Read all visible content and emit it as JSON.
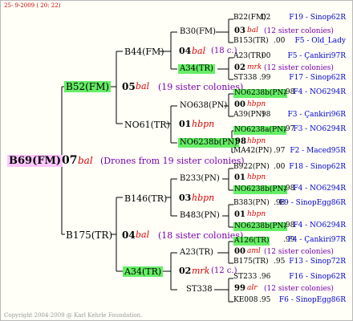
{
  "header": "25-  9-2009  ( 20: 22)",
  "footer": "Copyright 2004-2009 @ Karl Kehrle Foundation.",
  "root": {
    "name": "B69(FM)",
    "gen": "07",
    "origin": "bal",
    "note": "(Drones from 19 sister colonies)"
  },
  "level1": [
    {
      "name": "B52(FM)",
      "gen": "05",
      "origin": "bal",
      "note": "(19 sister colonies)"
    },
    {
      "name": "B175(TR)",
      "gen": "04",
      "origin": "bal",
      "note": "(18 sister colonies)"
    }
  ],
  "level2": [
    {
      "name": "B44(FM)",
      "gen": "04",
      "origin": "bal",
      "note": "(18 c.)"
    },
    {
      "name": "NO61(TR)",
      "gen": "01",
      "origin": "hbpn",
      "note": ""
    },
    {
      "name": "B146(TR)",
      "gen": "03",
      "origin": "hbpn",
      "note": ""
    },
    {
      "name": "A34(TR)",
      "gen": "02",
      "origin": "mrk",
      "note": "(12 c.)"
    }
  ],
  "level3": [
    {
      "name": "B30(FM)",
      "gen": "03",
      "origin": "bal",
      "note": "(12 sister colonies)"
    },
    {
      "name": "A34(TR)",
      "gen": "02",
      "origin": "mrk",
      "note": "(12 sister colonies)"
    },
    {
      "name": "NO638(PN)",
      "gen": "00",
      "origin": "hbpn",
      "note": ""
    },
    {
      "name": "NO6238b(PN)",
      "gen": "98",
      "origin": "hbpn",
      "note": ""
    },
    {
      "name": "B233(PN)",
      "gen": "01",
      "origin": "hbpn",
      "note": ""
    },
    {
      "name": "B483(PN)",
      "gen": "01",
      "origin": "hbpn",
      "note": ""
    },
    {
      "name": "A23(TR)",
      "gen": "00",
      "origin": "aml",
      "note": "(12 sister colonies)"
    },
    {
      "name": "ST338",
      "gen": "99",
      "origin": "alr",
      "note": "(12 sister colonies)"
    }
  ],
  "leaves": [
    {
      "name": "B22(FM)",
      "year": ".02",
      "ref": "F19 - Sinop62R"
    },
    {
      "name": "B153(TR)",
      "year": ".00",
      "ref": "F5 - Old_Lady"
    },
    {
      "name": "A23(TR)",
      "year": ".00",
      "ref": "F5 - Çankiri97R"
    },
    {
      "name": "ST338",
      "year": ".99",
      "ref": "F17 - Sinop62R"
    },
    {
      "name": "NO6238b(PN)",
      "year": ".98",
      "ref": "F4 - NO6294R"
    },
    {
      "name": "A39(PN)",
      "year": ".98",
      "ref": "F3 - Çankiri96R"
    },
    {
      "name": "NO6238a(PN)",
      "year": ".97",
      "ref": "F3 - NO6294R"
    },
    {
      "name": "MA42(PN)",
      "year": ".97",
      "ref": "F2 - Maced95R"
    },
    {
      "name": "B922(PN)",
      "year": ".00",
      "ref": "F18 - Sinop62R"
    },
    {
      "name": "NO6238b(PN)",
      "year": ".98",
      "ref": "F4 - NO6294R"
    },
    {
      "name": "B383(PN)",
      "year": ".98",
      "ref": "F9 - SinopEgg86R"
    },
    {
      "name": "NO6238b(PN)",
      "year": ".98",
      "ref": "F4 - NO6294R"
    },
    {
      "name": "A126(TR)",
      "year": ".99",
      "ref": "F4 - Çankiri97R"
    },
    {
      "name": "B175(TR)",
      "year": ".95",
      "ref": "F13 - Sinop72R"
    },
    {
      "name": "ST233",
      "year": ".96",
      "ref": "F16 - Sinop62R"
    },
    {
      "name": "KE008",
      "year": ".95",
      "ref": "F6 - SinopEgg86R"
    }
  ],
  "colors": {
    "highlight": "#66ee66",
    "root_bg": "#ffc6ff",
    "origin": "#dd0000",
    "note": "#7700aa",
    "ref": "#0000cc"
  }
}
